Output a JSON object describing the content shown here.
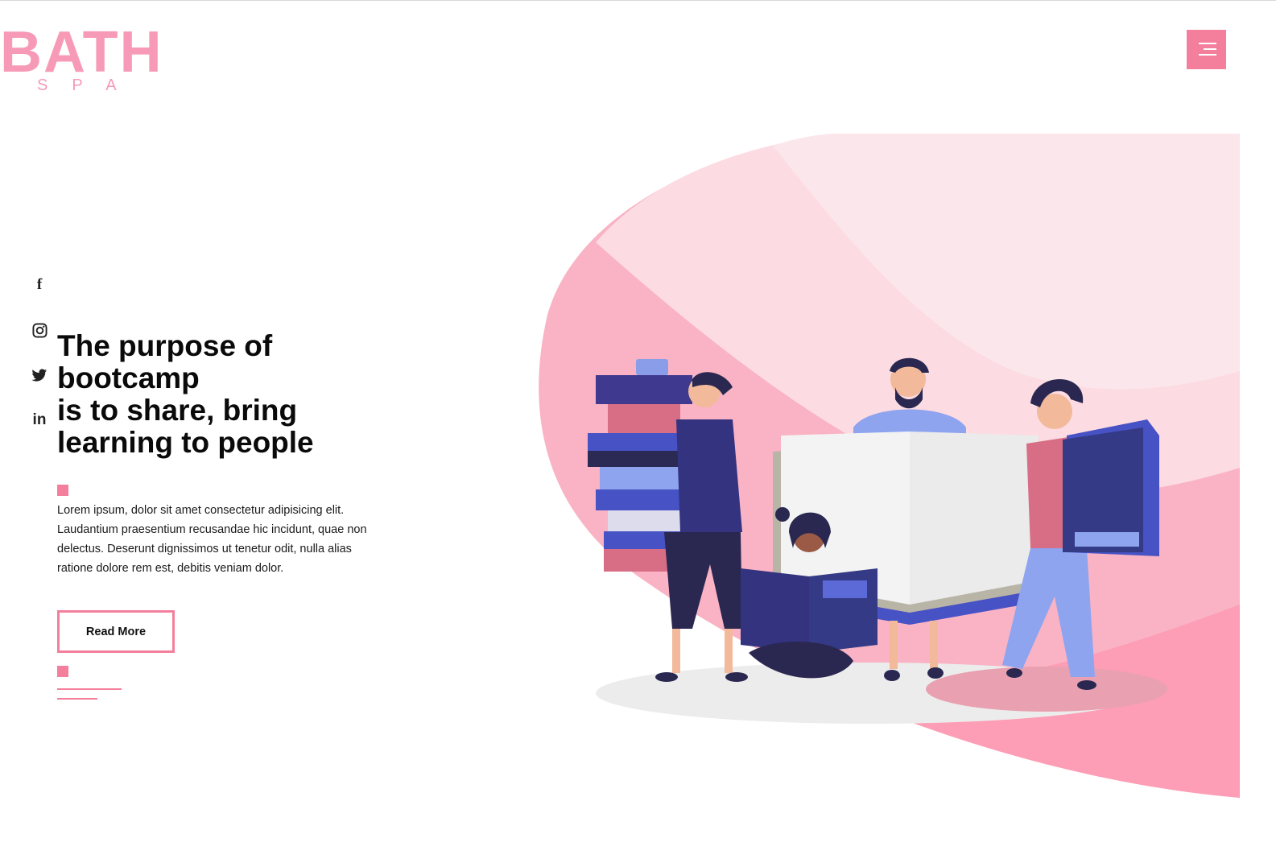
{
  "header": {
    "logo_main": "BATH",
    "logo_sub": "SPA",
    "menu_icon": "hamburger-menu-icon"
  },
  "social": [
    {
      "label": "f",
      "icon": "facebook-icon"
    },
    {
      "label": "instagram",
      "icon": "instagram-icon"
    },
    {
      "label": "twitter",
      "icon": "twitter-icon"
    },
    {
      "label": "in",
      "icon": "linkedin-icon"
    }
  ],
  "hero": {
    "title_lines": [
      "The purpose of",
      "bootcamp",
      "is to share, bring",
      "learning to people"
    ],
    "description": "Lorem ipsum, dolor sit amet consectetur adipisicing elit. Laudantium praesentium recusandae hic incidunt, quae non delectus. Deserunt dignissimos ut tenetur odit, nulla alias ratione dolore rem est, debitis veniam dolor.",
    "button_label": "Read More"
  },
  "colors": {
    "accent": "#f47f9d",
    "logo": "#f79ab7",
    "navy": "#343a85",
    "blob_light": "#fcdde3",
    "blob_mid": "#f8b5c6"
  }
}
